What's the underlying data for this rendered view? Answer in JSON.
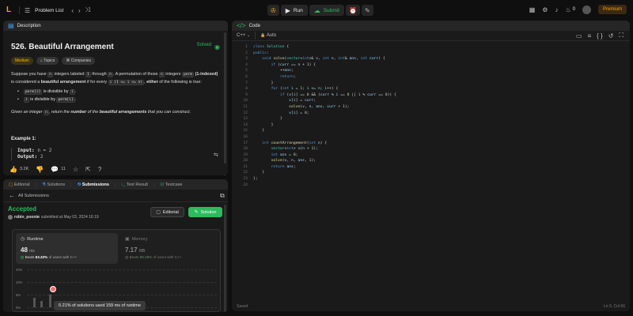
{
  "topbar": {
    "logo": "L",
    "title": "Problem List",
    "run_label": "Run",
    "submit_label": "Submit",
    "streak": "0",
    "premium_label": "Premium"
  },
  "description_panel": {
    "tab_label": "Description",
    "title": "526. Beautiful Arrangement",
    "solved_label": "Solved",
    "tags": [
      "Medium",
      "Topics",
      "Companies"
    ],
    "intro_1": "Suppose you have",
    "intro_code_n": "n",
    "intro_2": "integers labeled",
    "intro_code_1": "1",
    "intro_3": "through",
    "intro_4": ". A permutation of those",
    "intro_5": "integers",
    "intro_code_perm": "perm",
    "intro_6": "(1-indexed)",
    "intro_7": "is considered a",
    "intro_8": "beautiful arrangement",
    "intro_9": "if for every",
    "intro_code_i": "i (1 <= i <= n)",
    "intro_10": ",",
    "intro_11": "either",
    "intro_12": "of the following is true:",
    "cond1_code": "perm[i]",
    "cond1_text": "is divisible by",
    "cond1_code2": "i",
    "cond2_code": "i",
    "cond2_text": "is divisible by",
    "cond2_code2": "perm[i]",
    "given_1": "Given an integer",
    "given_code": "n",
    "given_2": ", return",
    "given_3": "the",
    "given_4": "number",
    "given_5": "of the",
    "given_6": "beautiful arrangements",
    "given_7": "that you can construct.",
    "example_title": "Example 1:",
    "example_input_label": "Input:",
    "example_input_value": "n = 2",
    "example_output_label": "Output:",
    "example_output_value": "2",
    "likes": "3.2K",
    "comments": "11"
  },
  "submission_panel": {
    "tabs": [
      "Editorial",
      "Solutions",
      "Submissions",
      "Test Result",
      "Testcase"
    ],
    "back_label": "All Submissions",
    "status": "Accepted",
    "user": "robin_pooniя",
    "submitted": "submitted at May 03, 2024 16:19",
    "editorial_btn": "Editorial",
    "solution_btn": "Solution",
    "runtime_label": "Runtime",
    "runtime_value": "48",
    "runtime_unit": "ms",
    "runtime_beats_prefix": "Beats",
    "runtime_beats": "63.32%",
    "runtime_beats_suffix": "of users with C++",
    "memory_label": "Memory",
    "memory_value": "7.17",
    "memory_unit": "MB",
    "memory_beats_prefix": "Beats",
    "memory_beats": "96.39%",
    "memory_beats_suffix": "of users with C++",
    "chart_ticks": [
      "20%",
      "10%",
      "5%",
      "0%"
    ],
    "tooltip": "0.21% of solutions used 159 ms of runtime"
  },
  "code_panel": {
    "tab_label": "Code",
    "language": "C++",
    "mode": "Auto",
    "status": "Saved",
    "cursor": "Ln 9, Col 66"
  },
  "colors": {
    "accent": "#ffa116",
    "success": "#2cbb5d"
  }
}
